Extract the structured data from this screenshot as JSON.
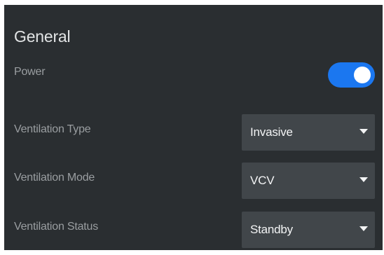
{
  "section": {
    "title": "General"
  },
  "power": {
    "label": "Power",
    "state": "on",
    "accent_color": "#1b77f0"
  },
  "ventilation_type": {
    "label": "Ventilation Type",
    "value": "Invasive"
  },
  "ventilation_mode": {
    "label": "Ventilation Mode",
    "value": "VCV"
  },
  "ventilation_status": {
    "label": "Ventilation Status",
    "value": "Standby"
  },
  "icons": {
    "dropdown": "chevron-down-icon"
  },
  "colors": {
    "panel_background": "#2a2e31",
    "select_background": "#41464a",
    "label_text": "#9a9ea1",
    "title_text": "#e2e4e5"
  }
}
